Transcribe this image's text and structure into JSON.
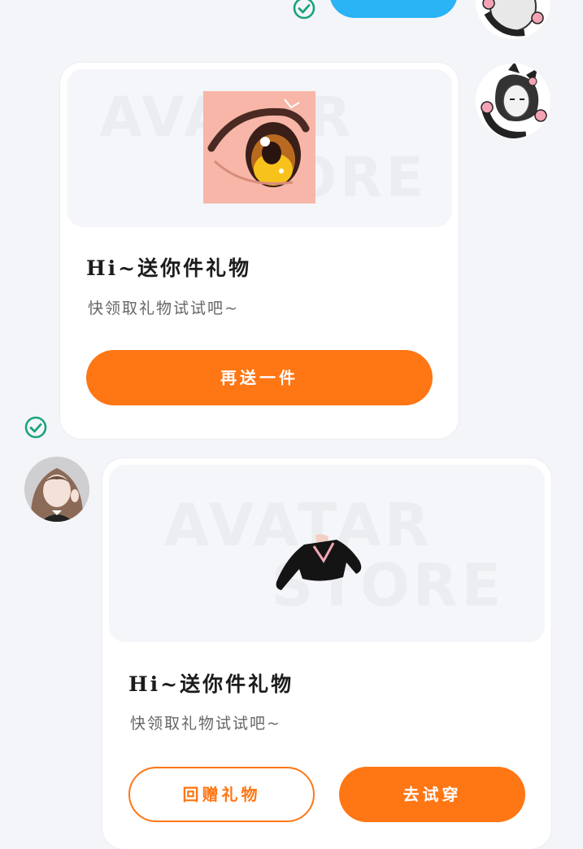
{
  "colors": {
    "accent": "#ff7614",
    "read_tick": "#1aa37a",
    "bubble_blue": "#2ab3f5"
  },
  "messages": [
    {
      "side": "outgoing",
      "preview_item": "eye-cosmetic",
      "watermark_line1": "AVATAR",
      "watermark_line2": "STORE",
      "title": "Hi~送你件礼物",
      "subtitle": "快领取礼物试试吧~",
      "primary_button": "再送一件"
    },
    {
      "side": "incoming",
      "preview_item": "black-sailor-top",
      "watermark_line1": "AVATAR",
      "watermark_line2": "STORE",
      "title": "Hi~送你件礼物",
      "subtitle": "快领取礼物试试吧~",
      "secondary_button": "回赠礼物",
      "primary_button": "去试穿"
    }
  ],
  "icons": [
    "check-circle-icon",
    "cat-ear-avatar",
    "girl-avatar"
  ]
}
